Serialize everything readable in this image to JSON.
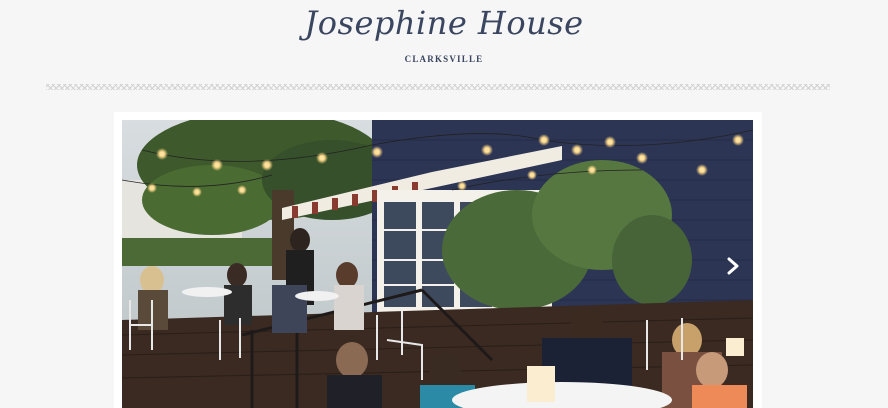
{
  "header": {
    "logo_text": "Josephine House",
    "location": "CLARKSVILLE"
  },
  "gallery": {
    "next_icon": "chevron-right-icon",
    "colors": {
      "siding": "#2c3554",
      "deck": "#3a2a22",
      "foliage": "#3e5a2c",
      "string_light": "#ffd98a"
    }
  }
}
